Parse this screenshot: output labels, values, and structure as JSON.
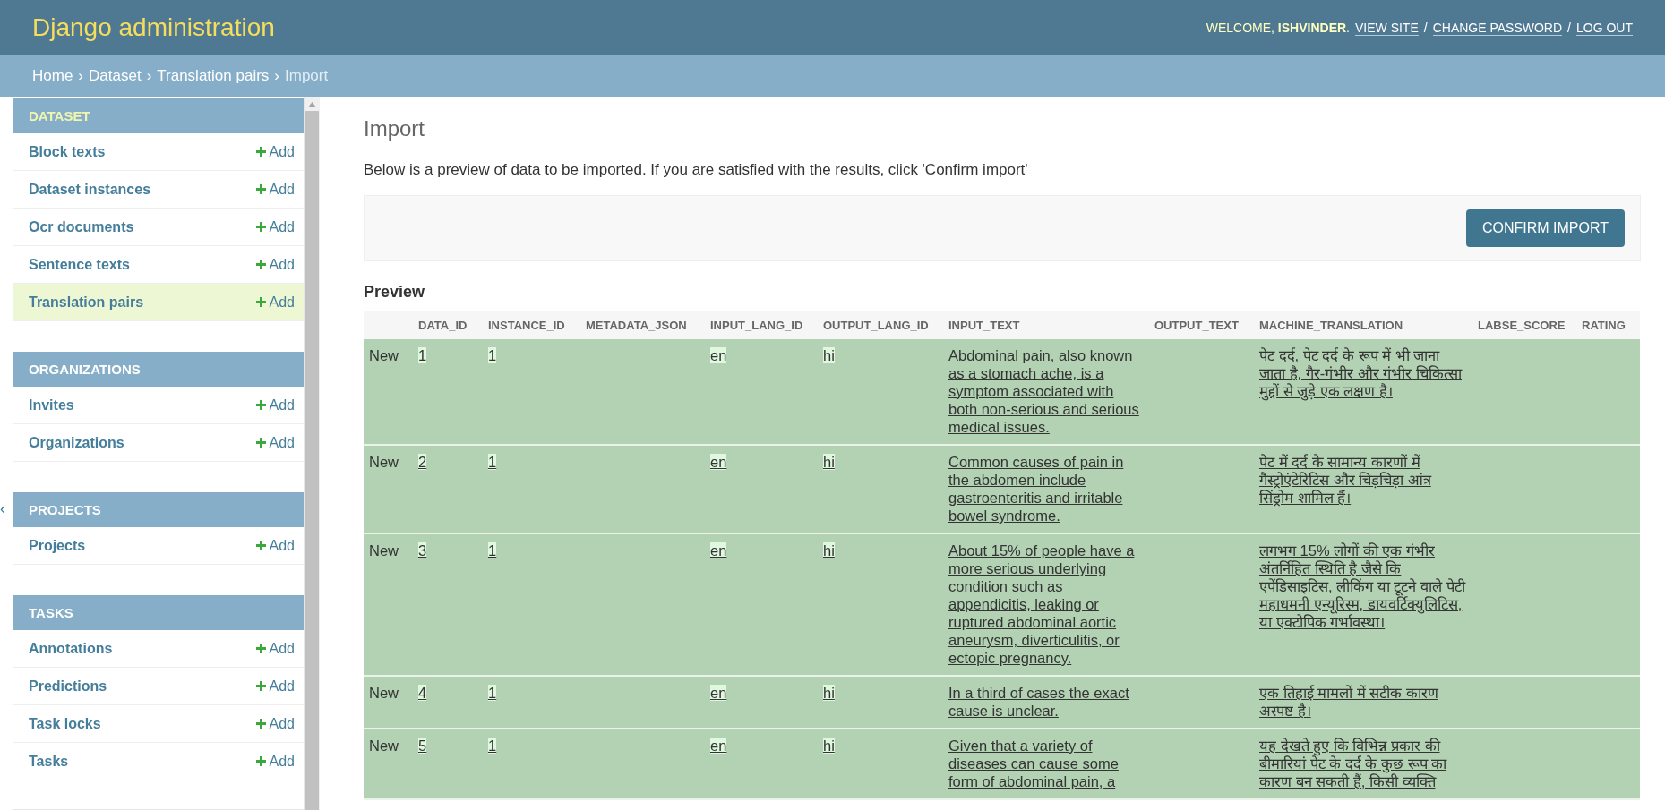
{
  "header": {
    "title": "Django administration",
    "welcome": "WELCOME, **ISHVINDER**.",
    "links": [
      "VIEW SITE",
      "CHANGE PASSWORD",
      "LOG OUT"
    ],
    "link_separator": "/"
  },
  "breadcrumbs": {
    "items": [
      "Home",
      "Dataset",
      "Translation pairs",
      "Import"
    ],
    "separator": "›"
  },
  "sidebar": {
    "toggle": "‹",
    "modules": [
      {
        "title": "DATASET",
        "current": true,
        "items": [
          {
            "label": "Block texts",
            "add": "Add",
            "selected": false
          },
          {
            "label": "Dataset instances",
            "add": "Add",
            "selected": false
          },
          {
            "label": "Ocr documents",
            "add": "Add",
            "selected": false
          },
          {
            "label": "Sentence texts",
            "add": "Add",
            "selected": false
          },
          {
            "label": "Translation pairs",
            "add": "Add",
            "selected": true
          }
        ]
      },
      {
        "title": "ORGANIZATIONS",
        "current": false,
        "items": [
          {
            "label": "Invites",
            "add": "Add",
            "selected": false
          },
          {
            "label": "Organizations",
            "add": "Add",
            "selected": false
          }
        ]
      },
      {
        "title": "PROJECTS",
        "current": false,
        "items": [
          {
            "label": "Projects",
            "add": "Add",
            "selected": false
          }
        ]
      },
      {
        "title": "TASKS",
        "current": false,
        "items": [
          {
            "label": "Annotations",
            "add": "Add",
            "selected": false
          },
          {
            "label": "Predictions",
            "add": "Add",
            "selected": false
          },
          {
            "label": "Task locks",
            "add": "Add",
            "selected": false
          },
          {
            "label": "Tasks",
            "add": "Add",
            "selected": false
          }
        ]
      }
    ]
  },
  "main": {
    "title": "Import",
    "description": "Below is a preview of data to be imported. If you are satisfied with the results, click 'Confirm import'",
    "confirm_button": "CONFIRM IMPORT",
    "preview_title": "Preview",
    "table": {
      "columns": [
        "DATA_ID",
        "INSTANCE_ID",
        "METADATA_JSON",
        "INPUT_LANG_ID",
        "OUTPUT_LANG_ID",
        "INPUT_TEXT",
        "OUTPUT_TEXT",
        "MACHINE_TRANSLATION",
        "LABSE_SCORE",
        "RATING"
      ],
      "rows": [
        {
          "import_type": "New",
          "data_id": "1",
          "instance_id": "1",
          "input_lang_id": "en",
          "output_lang_id": "hi",
          "input_text": "Abdominal pain, also known as a stomach ache, is a symptom associated with both non-serious and serious medical issues.",
          "machine_translation": "पेट दर्द, पेट दर्द के रूप में भी जाना जाता है, गैर-गंभीर और गंभीर चिकित्सा मुद्दों से जुड़े एक लक्षण है।"
        },
        {
          "import_type": "New",
          "data_id": "2",
          "instance_id": "1",
          "input_lang_id": "en",
          "output_lang_id": "hi",
          "input_text": "Common causes of pain in the abdomen include gastroenteritis and irritable bowel syndrome.",
          "machine_translation": "पेट में दर्द के सामान्य कारणों में गैस्ट्रोएंटेरिटिस और चिड़चिड़ा आंत्र सिंड्रोम शामिल हैं।"
        },
        {
          "import_type": "New",
          "data_id": "3",
          "instance_id": "1",
          "input_lang_id": "en",
          "output_lang_id": "hi",
          "input_text": "About 15% of people have a more serious underlying condition such as appendicitis, leaking or ruptured abdominal aortic aneurysm, diverticulitis, or ectopic pregnancy.",
          "machine_translation": "लगभग 15% लोगों की एक गंभीर अंतर्निहित स्थिति है जैसे कि एपेंडिसाइटिस, लीकिंग या टूटने वाले पेटी महाधमनी एन्यूरिस्म, डायवर्टिक्युलिटिस, या एक्टोपिक गर्भावस्था।"
        },
        {
          "import_type": "New",
          "data_id": "4",
          "instance_id": "1",
          "input_lang_id": "en",
          "output_lang_id": "hi",
          "input_text": "In a third of cases the exact cause is unclear.",
          "machine_translation": "एक तिहाई मामलों में सटीक कारण अस्पष्ट है।"
        },
        {
          "import_type": "New",
          "data_id": "5",
          "instance_id": "1",
          "input_lang_id": "en",
          "output_lang_id": "hi",
          "input_text": "Given that a variety of diseases can cause some form of abdominal pain, a",
          "machine_translation": "यह देखते हुए कि विभिन्न प्रकार की बीमारियां पेट के दर्द के कुछ रूप का कारण बन सकती हैं, किसी व्यक्ति"
        }
      ]
    }
  }
}
